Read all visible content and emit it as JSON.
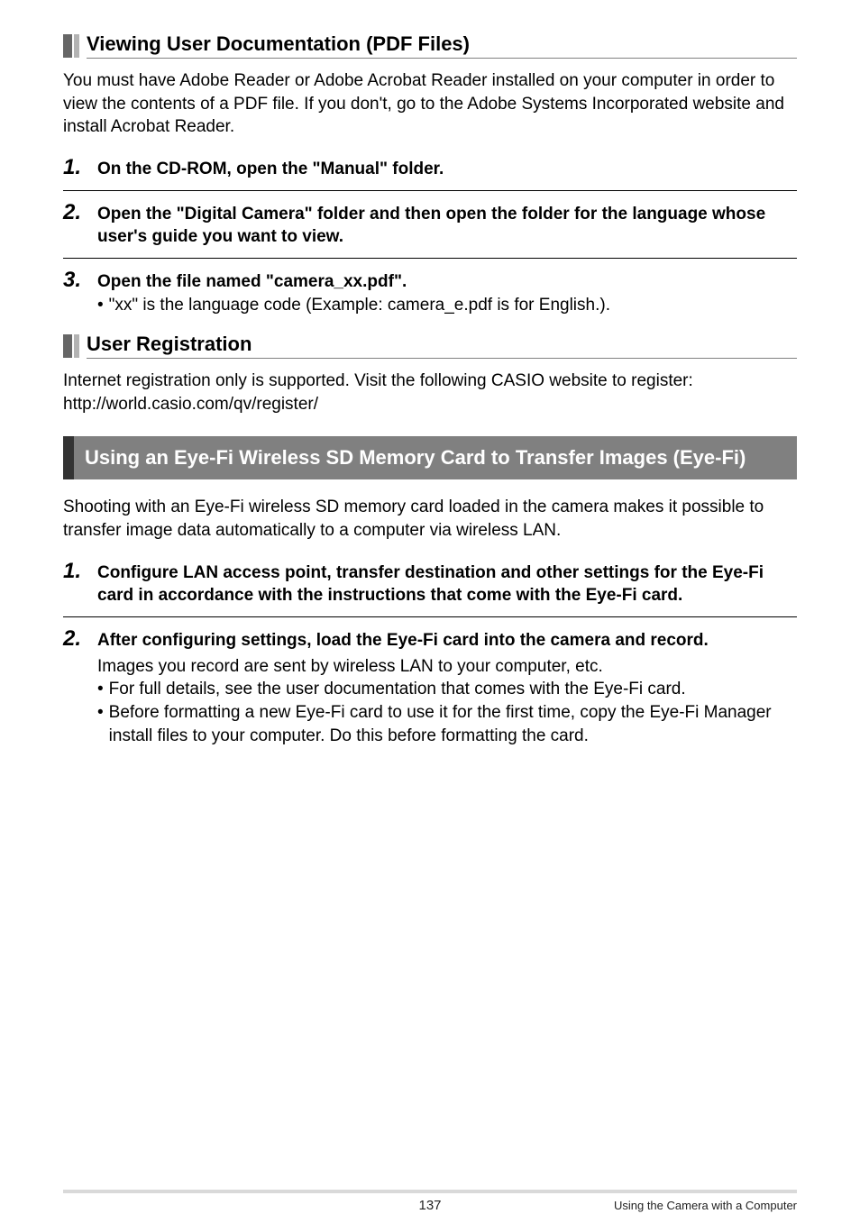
{
  "section1": {
    "title": "Viewing User Documentation (PDF Files)",
    "intro": "You must have Adobe Reader or Adobe Acrobat Reader installed on your computer in order to view the contents of a PDF file. If you don't, go to the Adobe Systems Incorporated website and install Acrobat Reader.",
    "step1_num": "1.",
    "step1_text": "On the CD-ROM, open the \"Manual\" folder.",
    "step2_num": "2.",
    "step2_text": "Open the \"Digital Camera\" folder and then open the folder for the language whose user's guide you want to view.",
    "step3_num": "3.",
    "step3_text": "Open the file named \"camera_xx.pdf\".",
    "step3_bullet": "\"xx\" is the language code (Example: camera_e.pdf is for English.)."
  },
  "section2": {
    "title": "User Registration",
    "text_line1": "Internet registration only is supported. Visit the following CASIO website to register:",
    "text_line2": "http://world.casio.com/qv/register/"
  },
  "banner": {
    "title": "Using an Eye-Fi Wireless SD Memory Card to Transfer Images (Eye-Fi)"
  },
  "section3": {
    "intro": "Shooting with an Eye-Fi wireless SD memory card loaded in the camera makes it possible to transfer image data automatically to a computer via wireless LAN.",
    "step1_num": "1.",
    "step1_text": "Configure LAN access point, transfer destination and other settings for the Eye-Fi card in accordance with the instructions that come with the Eye-Fi card.",
    "step2_num": "2.",
    "step2_text": "After configuring settings, load the Eye-Fi card into the camera and record.",
    "step2_body": "Images you record are sent by wireless LAN to your computer, etc.",
    "step2_bullet1": "For full details, see the user documentation that comes with the Eye-Fi card.",
    "step2_bullet2": "Before formatting a new Eye-Fi card to use it for the first time, copy the Eye-Fi Manager install files to your computer. Do this before formatting the card."
  },
  "footer": {
    "page": "137",
    "right": "Using the Camera with a Computer"
  }
}
